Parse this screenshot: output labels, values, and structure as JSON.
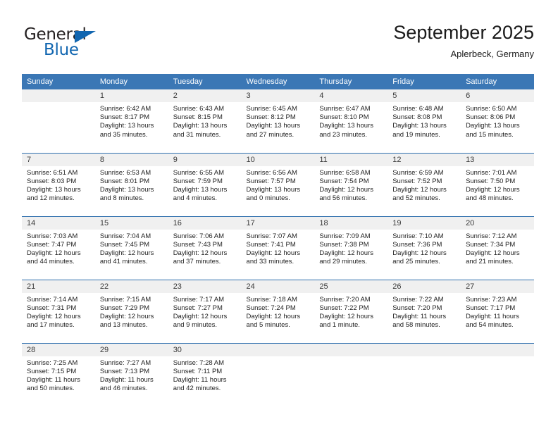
{
  "brand": {
    "name_part1": "General",
    "name_part2": "Blue",
    "accent_color": "#1166b0"
  },
  "header": {
    "title": "September 2025",
    "subtitle": "Aplerbeck, Germany"
  },
  "calendar": {
    "header_bg": "#3b77b5",
    "weekday_headers": [
      "Sunday",
      "Monday",
      "Tuesday",
      "Wednesday",
      "Thursday",
      "Friday",
      "Saturday"
    ],
    "weeks": [
      [
        {
          "day": "",
          "lines": []
        },
        {
          "day": "1",
          "lines": [
            "Sunrise: 6:42 AM",
            "Sunset: 8:17 PM",
            "Daylight: 13 hours",
            "and 35 minutes."
          ]
        },
        {
          "day": "2",
          "lines": [
            "Sunrise: 6:43 AM",
            "Sunset: 8:15 PM",
            "Daylight: 13 hours",
            "and 31 minutes."
          ]
        },
        {
          "day": "3",
          "lines": [
            "Sunrise: 6:45 AM",
            "Sunset: 8:12 PM",
            "Daylight: 13 hours",
            "and 27 minutes."
          ]
        },
        {
          "day": "4",
          "lines": [
            "Sunrise: 6:47 AM",
            "Sunset: 8:10 PM",
            "Daylight: 13 hours",
            "and 23 minutes."
          ]
        },
        {
          "day": "5",
          "lines": [
            "Sunrise: 6:48 AM",
            "Sunset: 8:08 PM",
            "Daylight: 13 hours",
            "and 19 minutes."
          ]
        },
        {
          "day": "6",
          "lines": [
            "Sunrise: 6:50 AM",
            "Sunset: 8:06 PM",
            "Daylight: 13 hours",
            "and 15 minutes."
          ]
        }
      ],
      [
        {
          "day": "7",
          "lines": [
            "Sunrise: 6:51 AM",
            "Sunset: 8:03 PM",
            "Daylight: 13 hours",
            "and 12 minutes."
          ]
        },
        {
          "day": "8",
          "lines": [
            "Sunrise: 6:53 AM",
            "Sunset: 8:01 PM",
            "Daylight: 13 hours",
            "and 8 minutes."
          ]
        },
        {
          "day": "9",
          "lines": [
            "Sunrise: 6:55 AM",
            "Sunset: 7:59 PM",
            "Daylight: 13 hours",
            "and 4 minutes."
          ]
        },
        {
          "day": "10",
          "lines": [
            "Sunrise: 6:56 AM",
            "Sunset: 7:57 PM",
            "Daylight: 13 hours",
            "and 0 minutes."
          ]
        },
        {
          "day": "11",
          "lines": [
            "Sunrise: 6:58 AM",
            "Sunset: 7:54 PM",
            "Daylight: 12 hours",
            "and 56 minutes."
          ]
        },
        {
          "day": "12",
          "lines": [
            "Sunrise: 6:59 AM",
            "Sunset: 7:52 PM",
            "Daylight: 12 hours",
            "and 52 minutes."
          ]
        },
        {
          "day": "13",
          "lines": [
            "Sunrise: 7:01 AM",
            "Sunset: 7:50 PM",
            "Daylight: 12 hours",
            "and 48 minutes."
          ]
        }
      ],
      [
        {
          "day": "14",
          "lines": [
            "Sunrise: 7:03 AM",
            "Sunset: 7:47 PM",
            "Daylight: 12 hours",
            "and 44 minutes."
          ]
        },
        {
          "day": "15",
          "lines": [
            "Sunrise: 7:04 AM",
            "Sunset: 7:45 PM",
            "Daylight: 12 hours",
            "and 41 minutes."
          ]
        },
        {
          "day": "16",
          "lines": [
            "Sunrise: 7:06 AM",
            "Sunset: 7:43 PM",
            "Daylight: 12 hours",
            "and 37 minutes."
          ]
        },
        {
          "day": "17",
          "lines": [
            "Sunrise: 7:07 AM",
            "Sunset: 7:41 PM",
            "Daylight: 12 hours",
            "and 33 minutes."
          ]
        },
        {
          "day": "18",
          "lines": [
            "Sunrise: 7:09 AM",
            "Sunset: 7:38 PM",
            "Daylight: 12 hours",
            "and 29 minutes."
          ]
        },
        {
          "day": "19",
          "lines": [
            "Sunrise: 7:10 AM",
            "Sunset: 7:36 PM",
            "Daylight: 12 hours",
            "and 25 minutes."
          ]
        },
        {
          "day": "20",
          "lines": [
            "Sunrise: 7:12 AM",
            "Sunset: 7:34 PM",
            "Daylight: 12 hours",
            "and 21 minutes."
          ]
        }
      ],
      [
        {
          "day": "21",
          "lines": [
            "Sunrise: 7:14 AM",
            "Sunset: 7:31 PM",
            "Daylight: 12 hours",
            "and 17 minutes."
          ]
        },
        {
          "day": "22",
          "lines": [
            "Sunrise: 7:15 AM",
            "Sunset: 7:29 PM",
            "Daylight: 12 hours",
            "and 13 minutes."
          ]
        },
        {
          "day": "23",
          "lines": [
            "Sunrise: 7:17 AM",
            "Sunset: 7:27 PM",
            "Daylight: 12 hours",
            "and 9 minutes."
          ]
        },
        {
          "day": "24",
          "lines": [
            "Sunrise: 7:18 AM",
            "Sunset: 7:24 PM",
            "Daylight: 12 hours",
            "and 5 minutes."
          ]
        },
        {
          "day": "25",
          "lines": [
            "Sunrise: 7:20 AM",
            "Sunset: 7:22 PM",
            "Daylight: 12 hours",
            "and 1 minute."
          ]
        },
        {
          "day": "26",
          "lines": [
            "Sunrise: 7:22 AM",
            "Sunset: 7:20 PM",
            "Daylight: 11 hours",
            "and 58 minutes."
          ]
        },
        {
          "day": "27",
          "lines": [
            "Sunrise: 7:23 AM",
            "Sunset: 7:17 PM",
            "Daylight: 11 hours",
            "and 54 minutes."
          ]
        }
      ],
      [
        {
          "day": "28",
          "lines": [
            "Sunrise: 7:25 AM",
            "Sunset: 7:15 PM",
            "Daylight: 11 hours",
            "and 50 minutes."
          ]
        },
        {
          "day": "29",
          "lines": [
            "Sunrise: 7:27 AM",
            "Sunset: 7:13 PM",
            "Daylight: 11 hours",
            "and 46 minutes."
          ]
        },
        {
          "day": "30",
          "lines": [
            "Sunrise: 7:28 AM",
            "Sunset: 7:11 PM",
            "Daylight: 11 hours",
            "and 42 minutes."
          ]
        },
        {
          "day": "",
          "lines": []
        },
        {
          "day": "",
          "lines": []
        },
        {
          "day": "",
          "lines": []
        },
        {
          "day": "",
          "lines": []
        }
      ]
    ]
  }
}
